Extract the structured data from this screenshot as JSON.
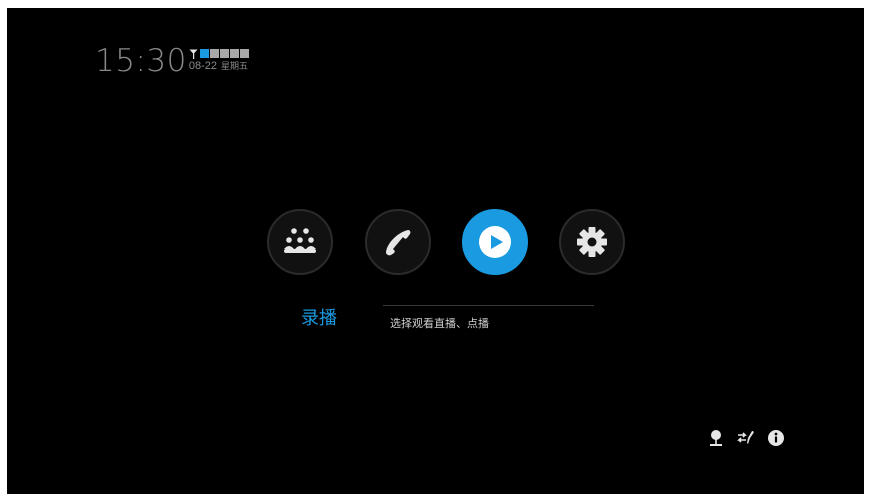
{
  "clock": {
    "time": "15:30",
    "date": "08-22",
    "weekday": "星期五",
    "signal_level": 0.2
  },
  "menu": {
    "items": [
      {
        "icon": "meeting-icon"
      },
      {
        "icon": "phone-icon"
      },
      {
        "icon": "play-icon"
      },
      {
        "icon": "gear-icon"
      }
    ],
    "selected_label": "录播",
    "selected_description": "选择观看直播、点播"
  },
  "status_bar": {
    "icons": [
      "network-icon",
      "transfer-icon",
      "info-icon"
    ]
  },
  "colors": {
    "accent": "#1a9ae0",
    "background": "#000000",
    "icon": "#e6e6e6",
    "muted_text": "#8a8a8a"
  }
}
